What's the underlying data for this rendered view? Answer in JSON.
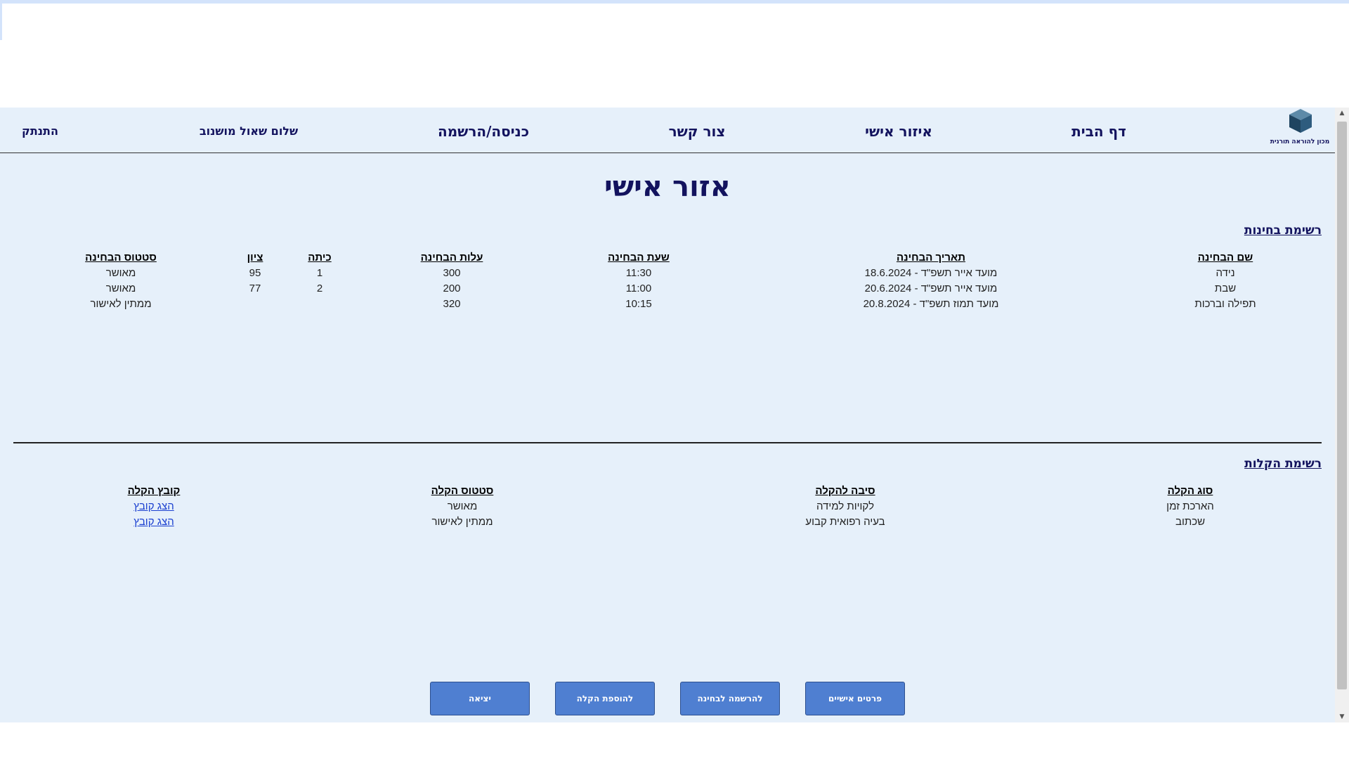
{
  "nav": {
    "logo_text": "מכון להוראה תורנית",
    "home": "דף הבית",
    "personal_area": "איזור אישי",
    "contact": "צור קשר",
    "login": "כניסה/הרשמה",
    "greeting": "שלום שאול מושנוב",
    "logout": "התנתק"
  },
  "page_title": "אזור אישי",
  "exams": {
    "title": "רשימת בחינות",
    "headers": {
      "name": "שם הבחינה",
      "date": "תאריך הבחינה",
      "time": "שעת הבחינה",
      "cost": "עלות הבחינה",
      "grade": "כיתה",
      "score": "ציון",
      "status": "סטטוס הבחינה"
    },
    "rows": [
      {
        "name": "נידה",
        "date": "מועד אייר תשפ\"ד - 18.6.2024",
        "time": "11:30",
        "cost": "300",
        "grade": "1",
        "score": "95",
        "status": "מאושר"
      },
      {
        "name": "שבת",
        "date": "מועד אייר תשפ\"ד - 20.6.2024",
        "time": "11:00",
        "cost": "200",
        "grade": "2",
        "score": "77",
        "status": "מאושר"
      },
      {
        "name": "תפילה וברכות",
        "date": "מועד תמוז תשפ\"ד - 20.8.2024",
        "time": "10:15",
        "cost": "320",
        "grade": "",
        "score": "",
        "status": "ממתין לאישור"
      }
    ]
  },
  "reliefs": {
    "title": "רשימת הקלות",
    "headers": {
      "type": "סוג הקלה",
      "reason": "סיבה להקלה",
      "status": "סטטוס הקלה",
      "file": "קובץ הקלה"
    },
    "rows": [
      {
        "type": "הארכת זמן",
        "reason": "לקויות למידה",
        "status": "מאושר",
        "file": "הצג קובץ"
      },
      {
        "type": "שכתוב",
        "reason": "בעיה רפואית קבוע",
        "status": "ממתין לאישור",
        "file": "הצג קובץ"
      }
    ]
  },
  "buttons": {
    "personal_details": "פרטים אישיים",
    "exam_registration": "להרשמה לבחינה",
    "add_relief": "להוספת הקלה",
    "exit": "יציאה"
  },
  "colors": {
    "page_background": "#e6f0fa",
    "nav_text": "#13135e",
    "button": "#4f7fd1",
    "link": "#1a3fd0"
  }
}
